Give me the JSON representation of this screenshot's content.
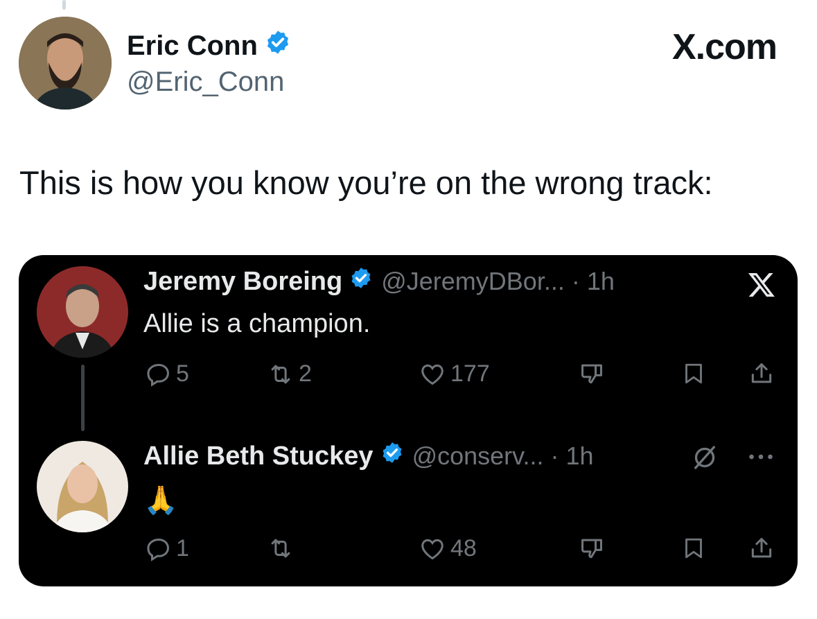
{
  "author": {
    "name": "Eric Conn",
    "handle": "@Eric_Conn",
    "verified": true
  },
  "site_label": "X.com",
  "tweet_text": "This is how you know you’re on the wrong track:",
  "colors": {
    "verified_blue": "#1d9bf0",
    "card_bg": "#000000",
    "card_text": "#e7e9ea",
    "muted": "#71767b"
  },
  "replies": [
    {
      "name": "Jeremy Boreing",
      "verified": true,
      "meta": "@JeremyDBor... · 1h",
      "text": "Allie is a champion.",
      "counts": {
        "replies": "5",
        "reposts": "2",
        "likes": "177"
      },
      "corner_icon": "x-logo-icon"
    },
    {
      "name": "Allie Beth Stuckey",
      "verified": true,
      "meta": "@conserv... · 1h",
      "text": "🙏",
      "counts": {
        "replies": "1",
        "reposts": "",
        "likes": "48"
      },
      "corner_icon": "grok-icon"
    }
  ]
}
